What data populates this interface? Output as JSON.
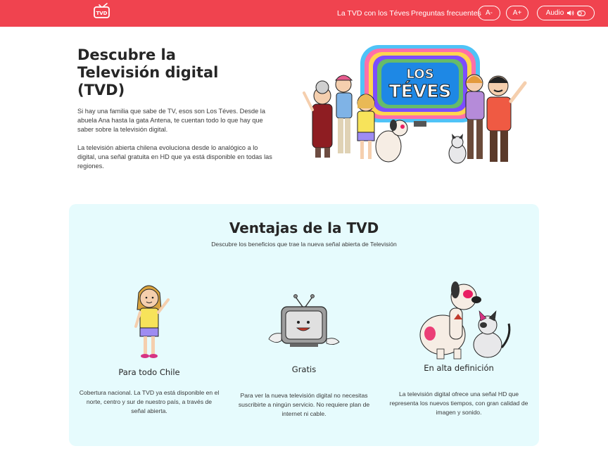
{
  "header": {
    "logo_text": "TVD",
    "nav": [
      {
        "label": "La TVD con los Téves"
      },
      {
        "label": "Preguntas frecuentes"
      }
    ],
    "font_decrease_label": "A-",
    "font_increase_label": "A+",
    "audio_label": "Audio",
    "brand_color": "#f0434f"
  },
  "hero": {
    "title": "Descubre la Televisión digital (TVD)",
    "paragraphs": [
      "Si hay una familia que sabe de TV, esos son Los Téves. Desde la abuela Ana hasta la gata Antena, te cuentan todo lo que hay que saber sobre la televisión digital.",
      "La televisión abierta chilena evoluciona desde lo analógico a lo digital, una señal gratuita en HD que ya está disponible en todas las regiones."
    ],
    "sign_text_top": "LOS",
    "sign_text_bottom": "TÉVES"
  },
  "ventajas": {
    "title": "Ventajas de la TVD",
    "subtitle": "Descubre los beneficios que trae la nueva señal abierta de Televisión",
    "background": "#e6fbfd",
    "features": [
      {
        "title": "Para todo Chile",
        "description": "Cobertura nacional. La TVD ya está disponible en el norte, centro y sur de nuestro país, a través de señal abierta.",
        "icon": "girl-waving-illustration"
      },
      {
        "title": "Gratis",
        "description": "Para ver la nueva televisión digital no necesitas suscribirte a ningún servicio. No requiere plan de internet ni cable.",
        "icon": "retro-tv-character-illustration"
      },
      {
        "title": "En alta definición",
        "description": "La televisión digital ofrece una señal HD que representa los nuevos tiempos, con gran calidad de imagen y sonido.",
        "icon": "dog-and-cat-illustration"
      }
    ]
  }
}
